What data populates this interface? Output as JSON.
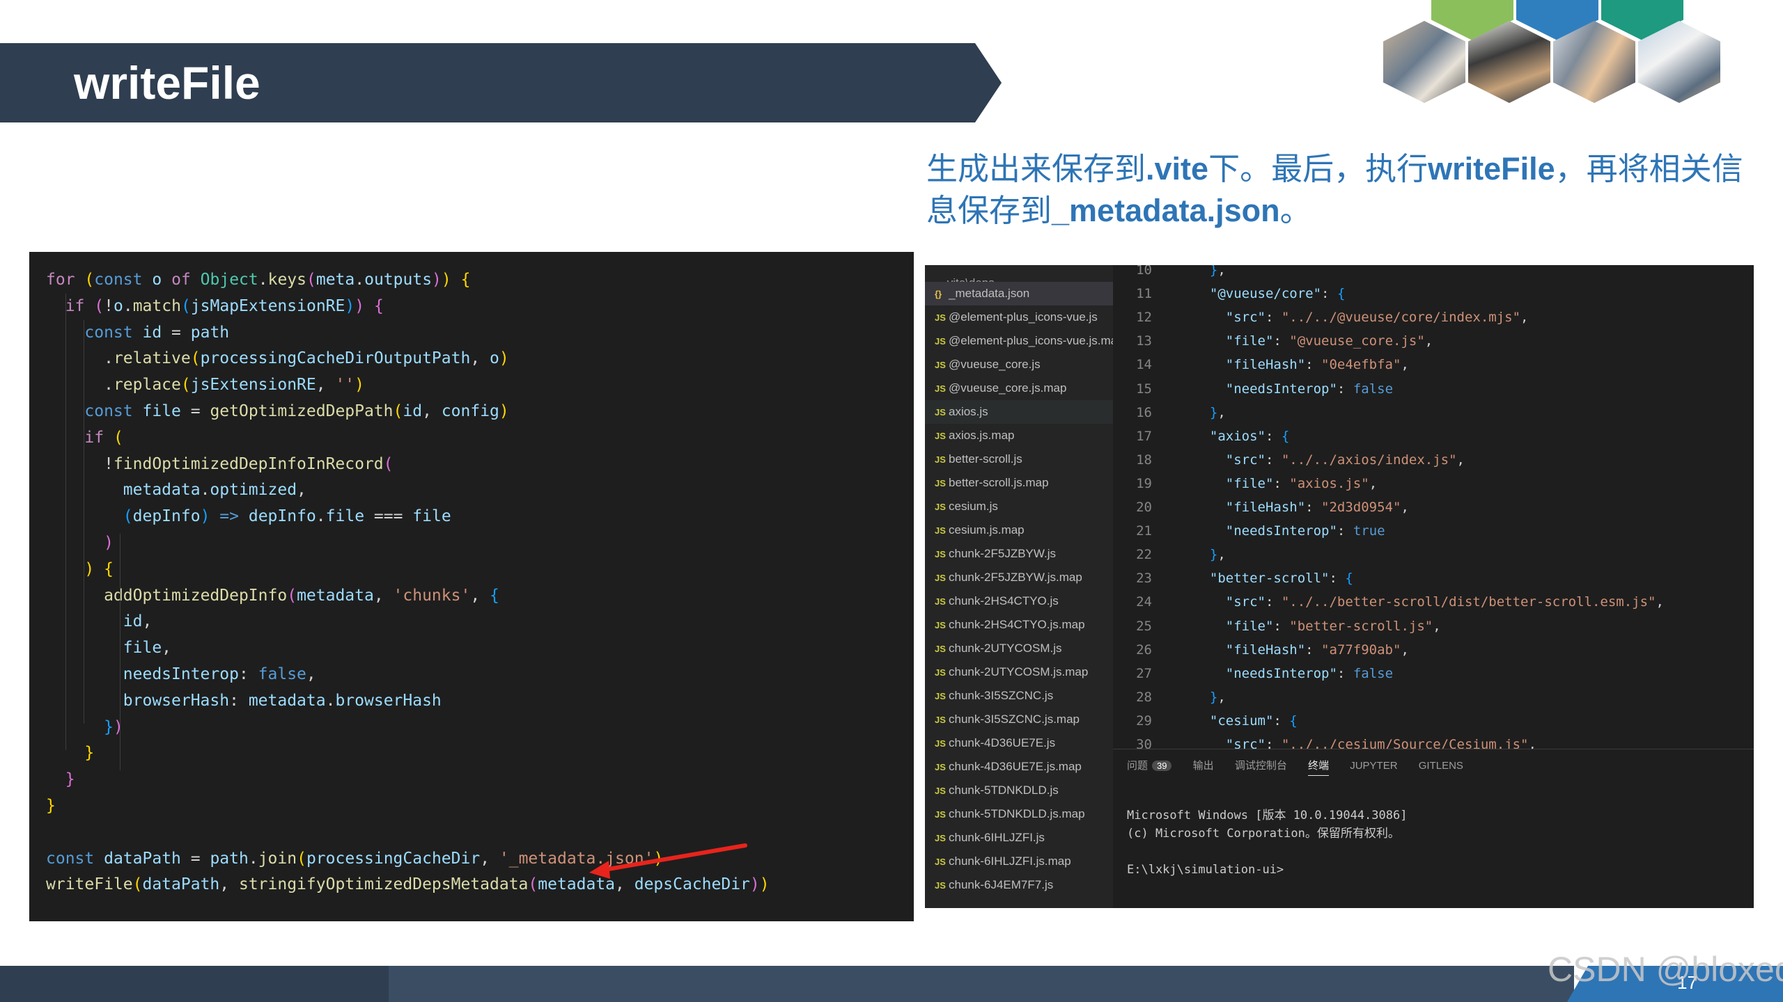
{
  "slide": {
    "title": "writeFile",
    "caption_segments": [
      "生成出来保存到",
      ".vite",
      "下。最后，执行",
      "writeFile",
      "，再将相关信息保存到",
      "_metadata.json",
      "。"
    ],
    "page_number": "17",
    "watermark": "CSDN @bloxed"
  },
  "colors": {
    "banner": "#2f3e50",
    "caption": "#2e75b6",
    "footer_accent": "#2e75b6",
    "arrow": "#e8241c"
  },
  "code_left": {
    "lines": [
      "for (const o of Object.keys(meta.outputs)) {",
      "  if (!o.match(jsMapExtensionRE)) {",
      "    const id = path",
      "      .relative(processingCacheDirOutputPath, o)",
      "      .replace(jsExtensionRE, '')",
      "    const file = getOptimizedDepPath(id, config)",
      "    if (",
      "      !findOptimizedDepInfoInRecord(",
      "        metadata.optimized,",
      "        (depInfo) => depInfo.file === file",
      "      )",
      "    ) {",
      "      addOptimizedDepInfo(metadata, 'chunks', {",
      "        id,",
      "        file,",
      "        needsInterop: false,",
      "        browserHash: metadata.browserHash",
      "      })",
      "    }",
      "  }",
      "}",
      "",
      "const dataPath = path.join(processingCacheDir, '_metadata.json')",
      "writeFile(dataPath, stringifyOptimizedDepsMetadata(metadata, depsCacheDir))"
    ]
  },
  "explorer": {
    "folder": ".vite\\deps",
    "files": [
      {
        "icon": "{}",
        "name": "_metadata.json",
        "selected": true
      },
      {
        "icon": "JS",
        "name": "@element-plus_icons-vue.js"
      },
      {
        "icon": "JS",
        "name": "@element-plus_icons-vue.js.map"
      },
      {
        "icon": "JS",
        "name": "@vueuse_core.js"
      },
      {
        "icon": "JS",
        "name": "@vueuse_core.js.map"
      },
      {
        "icon": "JS",
        "name": "axios.js",
        "hover": true
      },
      {
        "icon": "JS",
        "name": "axios.js.map"
      },
      {
        "icon": "JS",
        "name": "better-scroll.js"
      },
      {
        "icon": "JS",
        "name": "better-scroll.js.map"
      },
      {
        "icon": "JS",
        "name": "cesium.js"
      },
      {
        "icon": "JS",
        "name": "cesium.js.map"
      },
      {
        "icon": "JS",
        "name": "chunk-2F5JZBYW.js"
      },
      {
        "icon": "JS",
        "name": "chunk-2F5JZBYW.js.map"
      },
      {
        "icon": "JS",
        "name": "chunk-2HS4CTYO.js"
      },
      {
        "icon": "JS",
        "name": "chunk-2HS4CTYO.js.map"
      },
      {
        "icon": "JS",
        "name": "chunk-2UTYCOSM.js"
      },
      {
        "icon": "JS",
        "name": "chunk-2UTYCOSM.js.map"
      },
      {
        "icon": "JS",
        "name": "chunk-3I5SZCNC.js"
      },
      {
        "icon": "JS",
        "name": "chunk-3I5SZCNC.js.map"
      },
      {
        "icon": "JS",
        "name": "chunk-4D36UE7E.js"
      },
      {
        "icon": "JS",
        "name": "chunk-4D36UE7E.js.map"
      },
      {
        "icon": "JS",
        "name": "chunk-5TDNKDLD.js"
      },
      {
        "icon": "JS",
        "name": "chunk-5TDNKDLD.js.map"
      },
      {
        "icon": "JS",
        "name": "chunk-6IHLJZFI.js"
      },
      {
        "icon": "JS",
        "name": "chunk-6IHLJZFI.js.map"
      },
      {
        "icon": "JS",
        "name": "chunk-6J4EM7F7.js"
      }
    ]
  },
  "editor": {
    "line_numbers": [
      "10",
      "11",
      "12",
      "13",
      "14",
      "15",
      "16",
      "17",
      "18",
      "19",
      "20",
      "21",
      "22",
      "23",
      "24",
      "25",
      "26",
      "27",
      "28",
      "29",
      "30"
    ],
    "lines": [
      "  },",
      "  \"@vueuse/core\": {",
      "    \"src\": \"../../@vueuse/core/index.mjs\",",
      "    \"file\": \"@vueuse_core.js\",",
      "    \"fileHash\": \"0e4efbfa\",",
      "    \"needsInterop\": false",
      "  },",
      "  \"axios\": {",
      "    \"src\": \"../../axios/index.js\",",
      "    \"file\": \"axios.js\",",
      "    \"fileHash\": \"2d3d0954\",",
      "    \"needsInterop\": true",
      "  },",
      "  \"better-scroll\": {",
      "    \"src\": \"../../better-scroll/dist/better-scroll.esm.js\",",
      "    \"file\": \"better-scroll.js\",",
      "    \"fileHash\": \"a77f90ab\",",
      "    \"needsInterop\": false",
      "  },",
      "  \"cesium\": {",
      "    \"src\": \"../../cesium/Source/Cesium.js\","
    ]
  },
  "panel": {
    "tabs": [
      "问题",
      "输出",
      "调试控制台",
      "终端",
      "JUPYTER",
      "GITLENS"
    ],
    "active_tab": "终端",
    "problems_count": "39",
    "terminal_lines": [
      "Microsoft Windows [版本 10.0.19044.3086]",
      "(c) Microsoft Corporation。保留所有权利。",
      "",
      "E:\\lxkj\\simulation-ui>"
    ]
  }
}
